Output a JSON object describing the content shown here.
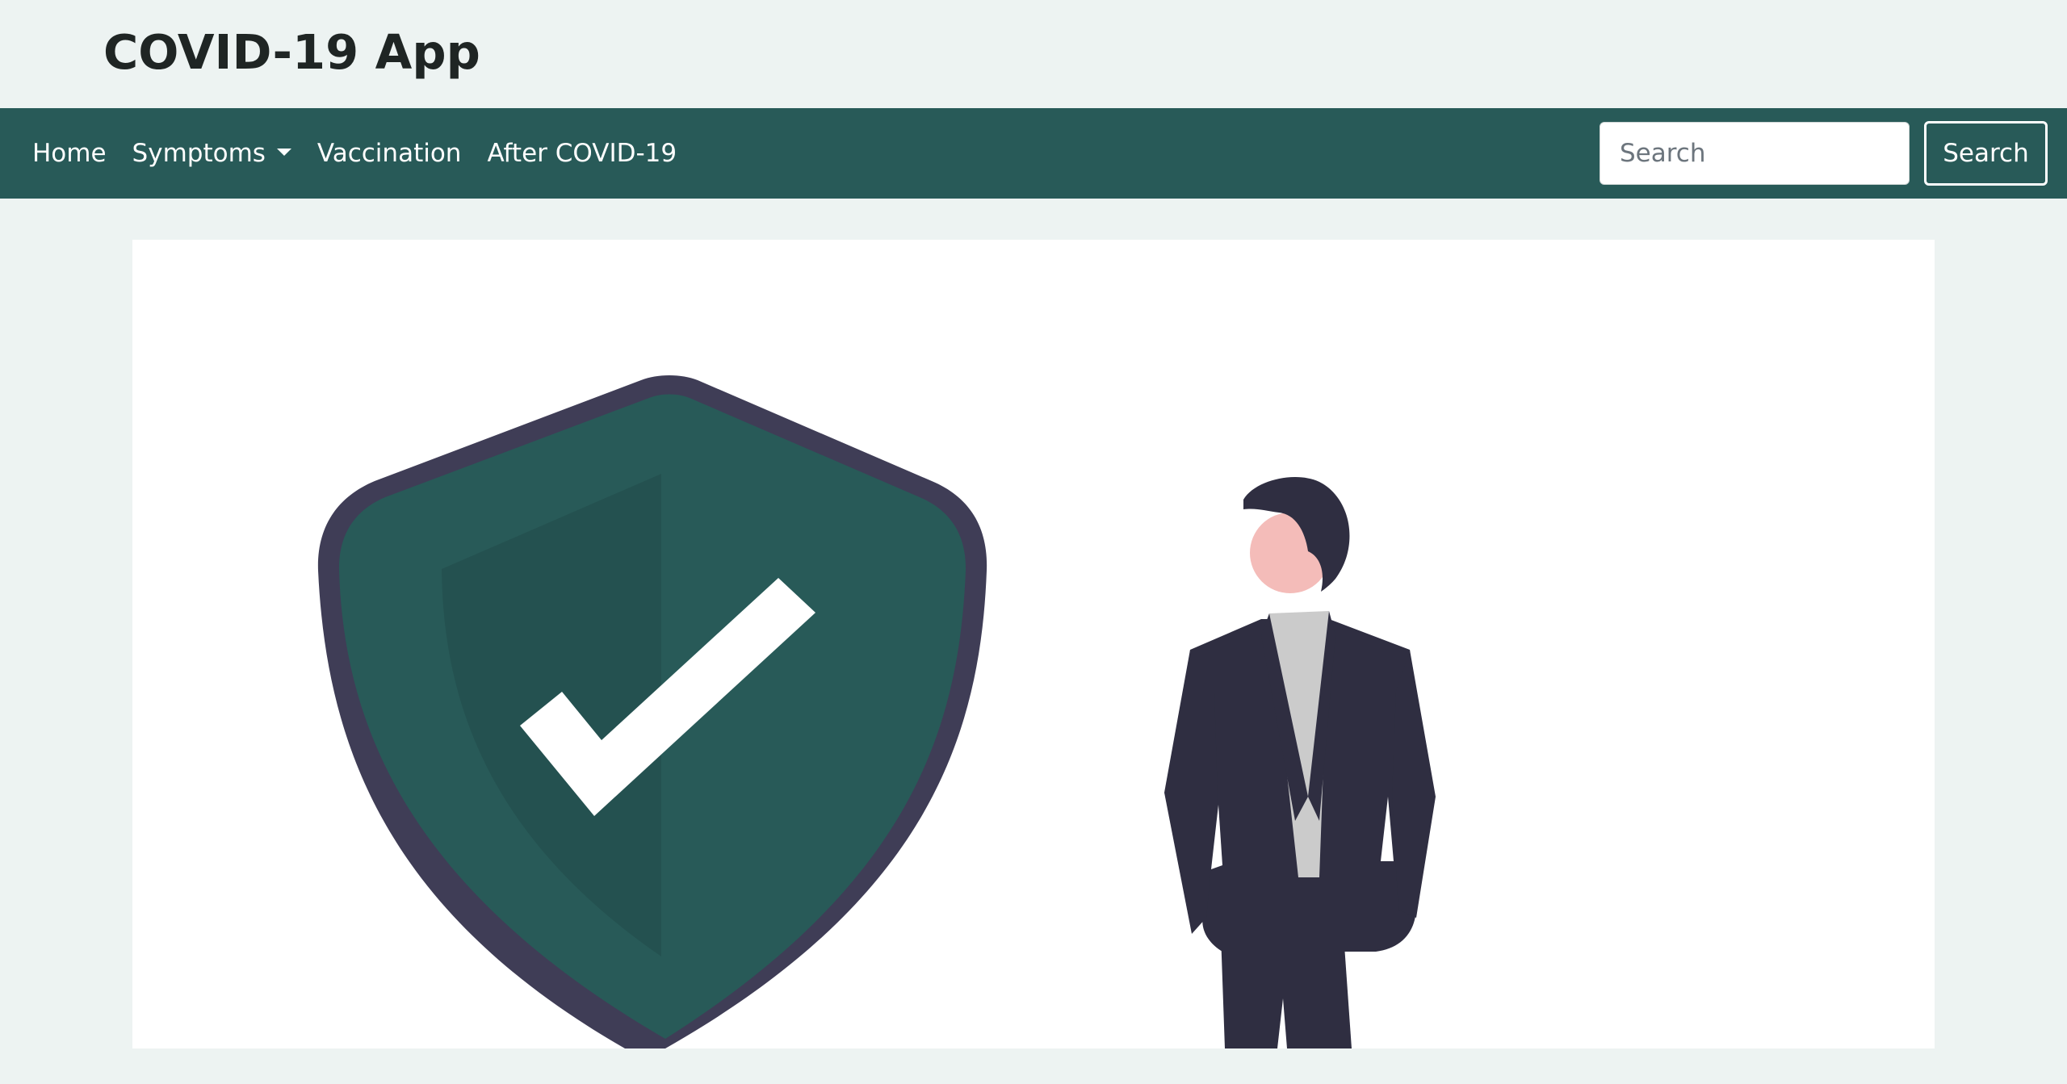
{
  "app": {
    "title": "COVID-19 App"
  },
  "nav": {
    "items": [
      {
        "label": "Home"
      },
      {
        "label": "Symptoms",
        "has_dropdown": true
      },
      {
        "label": "Vaccination"
      },
      {
        "label": "After COVID-19"
      }
    ]
  },
  "search": {
    "placeholder": "Search",
    "value": "",
    "button_label": "Search"
  },
  "hero": {
    "illustration_icons": [
      "shield-check-icon",
      "person-illustration"
    ]
  },
  "colors": {
    "page_bg": "#edf3f2",
    "navbar_bg": "#285a58",
    "shield_fill": "#285a58",
    "shield_outline": "#3f3d56",
    "suit": "#2f2e41",
    "skin": "#f4bcb9",
    "shirt": "#cbcbcb"
  }
}
